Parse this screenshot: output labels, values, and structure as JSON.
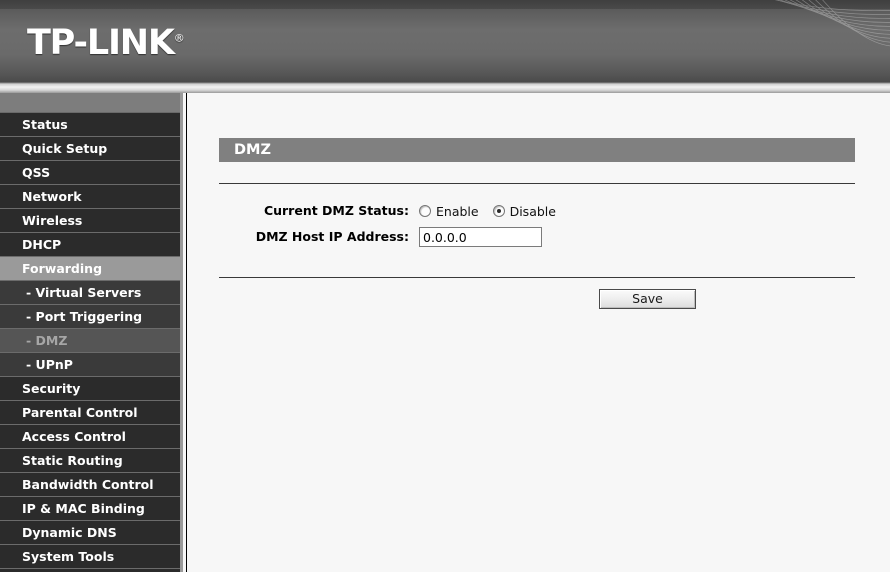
{
  "brand": {
    "name": "TP-LINK",
    "trademark": "®"
  },
  "sidebar": {
    "items": [
      {
        "label": "Status",
        "state": "normal",
        "level": "top"
      },
      {
        "label": "Quick Setup",
        "state": "normal",
        "level": "top"
      },
      {
        "label": "QSS",
        "state": "normal",
        "level": "top"
      },
      {
        "label": "Network",
        "state": "normal",
        "level": "top"
      },
      {
        "label": "Wireless",
        "state": "normal",
        "level": "top"
      },
      {
        "label": "DHCP",
        "state": "normal",
        "level": "top"
      },
      {
        "label": "Forwarding",
        "state": "highlight",
        "level": "top"
      },
      {
        "label": "- Virtual Servers",
        "state": "normal",
        "level": "sub"
      },
      {
        "label": "- Port Triggering",
        "state": "normal",
        "level": "sub"
      },
      {
        "label": "- DMZ",
        "state": "current",
        "level": "sub"
      },
      {
        "label": "- UPnP",
        "state": "normal",
        "level": "sub"
      },
      {
        "label": "Security",
        "state": "normal",
        "level": "top"
      },
      {
        "label": "Parental Control",
        "state": "normal",
        "level": "top"
      },
      {
        "label": "Access Control",
        "state": "normal",
        "level": "top"
      },
      {
        "label": "Static Routing",
        "state": "normal",
        "level": "top"
      },
      {
        "label": "Bandwidth Control",
        "state": "normal",
        "level": "top"
      },
      {
        "label": "IP & MAC Binding",
        "state": "normal",
        "level": "top"
      },
      {
        "label": "Dynamic DNS",
        "state": "normal",
        "level": "top"
      },
      {
        "label": "System Tools",
        "state": "normal",
        "level": "top"
      }
    ]
  },
  "main": {
    "panel_title": "DMZ",
    "fields": {
      "status": {
        "label": "Current DMZ Status:",
        "options": [
          {
            "label": "Enable",
            "selected": false
          },
          {
            "label": "Disable",
            "selected": true
          }
        ]
      },
      "host_ip": {
        "label": "DMZ Host IP Address:",
        "value": "0.0.0.0",
        "placeholder": "0.0.0.0"
      }
    },
    "save_label": "Save"
  },
  "colors": {
    "sidebar_bg": "#2b2b2b",
    "sidebar_sub_bg": "#3a3a3a",
    "highlight_bg": "#9a9a9a",
    "current_bg": "#555555",
    "panel_title_bg": "#808080",
    "content_bg": "#f7f7f7",
    "header_gray": "#6d6d6d"
  }
}
